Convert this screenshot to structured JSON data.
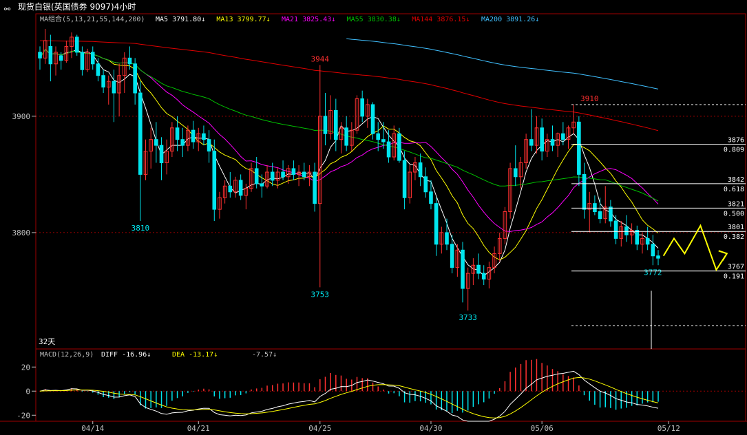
{
  "window": {
    "title": "现货白银(英国债券 9097)4小时",
    "icon": "link-icon"
  },
  "colors": {
    "up": "#ff3030",
    "down": "#00e5ee",
    "ma5": "#ffffff",
    "ma13": "#ffff00",
    "ma21": "#ff00ff",
    "ma55": "#00c000",
    "ma144": "#e00000",
    "ma200": "#40c0ff",
    "frame": "#a00000",
    "axis_text": "#c0c0c0",
    "fib_line": "#ffffff",
    "projection": "#ffff00"
  },
  "legend": {
    "title": "MA组合(5,13,21,55,144,200)",
    "items": [
      {
        "label": "MA5",
        "value": "3791.80",
        "arrow": "↓",
        "color": "#ffffff"
      },
      {
        "label": "MA13",
        "value": "3799.77",
        "arrow": "↓",
        "color": "#ffff00"
      },
      {
        "label": "MA21",
        "value": "3825.43",
        "arrow": "↓",
        "color": "#ff00ff"
      },
      {
        "label": "MA55",
        "value": "3830.38",
        "arrow": "↓",
        "color": "#00c000"
      },
      {
        "label": "MA144",
        "value": "3876.15",
        "arrow": "↓",
        "color": "#e00000"
      },
      {
        "label": "MA200",
        "value": "3891.26",
        "arrow": "↓",
        "color": "#40c0ff"
      }
    ]
  },
  "macd_legend": {
    "title": "MACD(12,26,9)",
    "diff_label": "DIFF",
    "diff_value": "-16.96",
    "diff_arrow": "↓",
    "dea_label": "DEA",
    "dea_value": "-13.17",
    "dea_arrow": "↓",
    "macd_value": "-7.57",
    "macd_arrow": "↓"
  },
  "period_label": "32天",
  "chart_data": [
    {
      "type": "candlestick",
      "title": "现货白银(英国债券 9097)4小时",
      "ylim": [
        3700,
        3978
      ],
      "y_ticks": [
        3800,
        3900
      ],
      "x_tick_labels": [
        {
          "label": "04/14",
          "index": 10
        },
        {
          "label": "04/21",
          "index": 30
        },
        {
          "label": "04/25",
          "index": 53
        },
        {
          "label": "04/30",
          "index": 74
        },
        {
          "label": "05/06",
          "index": 95
        },
        {
          "label": "05/12",
          "index": 119
        }
      ],
      "candles": [
        [
          3955,
          3960,
          3940,
          3950
        ],
        [
          3950,
          3975,
          3945,
          3965
        ],
        [
          3960,
          3970,
          3930,
          3945
        ],
        [
          3945,
          3960,
          3935,
          3955
        ],
        [
          3952,
          3955,
          3940,
          3948
        ],
        [
          3948,
          3965,
          3946,
          3960
        ],
        [
          3960,
          3972,
          3950,
          3968
        ],
        [
          3968,
          3970,
          3952,
          3955
        ],
        [
          3955,
          3960,
          3935,
          3940
        ],
        [
          3940,
          3958,
          3938,
          3955
        ],
        [
          3955,
          3960,
          3940,
          3945
        ],
        [
          3945,
          3950,
          3930,
          3935
        ],
        [
          3935,
          3940,
          3920,
          3925
        ],
        [
          3925,
          3935,
          3910,
          3930
        ],
        [
          3930,
          3940,
          3895,
          3920
        ],
        [
          3920,
          3945,
          3900,
          3935
        ],
        [
          3935,
          3955,
          3920,
          3950
        ],
        [
          3950,
          3960,
          3940,
          3945
        ],
        [
          3945,
          3950,
          3910,
          3920
        ],
        [
          3920,
          3930,
          3810,
          3850
        ],
        [
          3850,
          3880,
          3845,
          3870
        ],
        [
          3870,
          3890,
          3855,
          3880
        ],
        [
          3880,
          3895,
          3860,
          3875
        ],
        [
          3875,
          3882,
          3845,
          3860
        ],
        [
          3860,
          3880,
          3850,
          3870
        ],
        [
          3870,
          3895,
          3865,
          3890
        ],
        [
          3890,
          3900,
          3870,
          3880
        ],
        [
          3880,
          3890,
          3865,
          3875
        ],
        [
          3875,
          3892,
          3870,
          3888
        ],
        [
          3888,
          3896,
          3872,
          3878
        ],
        [
          3878,
          3890,
          3870,
          3885
        ],
        [
          3885,
          3892,
          3875,
          3880
        ],
        [
          3880,
          3888,
          3860,
          3870
        ],
        [
          3870,
          3880,
          3810,
          3820
        ],
        [
          3820,
          3835,
          3812,
          3830
        ],
        [
          3830,
          3845,
          3825,
          3840
        ],
        [
          3840,
          3852,
          3830,
          3835
        ],
        [
          3835,
          3848,
          3830,
          3845
        ],
        [
          3845,
          3850,
          3828,
          3832
        ],
        [
          3832,
          3842,
          3820,
          3838
        ],
        [
          3838,
          3860,
          3835,
          3855
        ],
        [
          3855,
          3865,
          3838,
          3842
        ],
        [
          3842,
          3850,
          3830,
          3840
        ],
        [
          3840,
          3858,
          3838,
          3852
        ],
        [
          3852,
          3860,
          3840,
          3845
        ],
        [
          3845,
          3856,
          3838,
          3852
        ],
        [
          3852,
          3862,
          3845,
          3848
        ],
        [
          3848,
          3858,
          3842,
          3855
        ],
        [
          3855,
          3862,
          3845,
          3850
        ],
        [
          3850,
          3858,
          3840,
          3852
        ],
        [
          3852,
          3860,
          3845,
          3848
        ],
        [
          3848,
          3858,
          3840,
          3852
        ],
        [
          3852,
          3860,
          3818,
          3825
        ],
        [
          3825,
          3944,
          3753,
          3900
        ],
        [
          3900,
          3920,
          3875,
          3885
        ],
        [
          3885,
          3918,
          3880,
          3905
        ],
        [
          3905,
          3915,
          3870,
          3880
        ],
        [
          3880,
          3895,
          3868,
          3890
        ],
        [
          3890,
          3900,
          3870,
          3875
        ],
        [
          3875,
          3895,
          3870,
          3888
        ],
        [
          3888,
          3918,
          3885,
          3915
        ],
        [
          3915,
          3922,
          3895,
          3900
        ],
        [
          3900,
          3915,
          3890,
          3910
        ],
        [
          3910,
          3912,
          3880,
          3885
        ],
        [
          3885,
          3895,
          3870,
          3880
        ],
        [
          3880,
          3895,
          3872,
          3878
        ],
        [
          3878,
          3888,
          3860,
          3865
        ],
        [
          3865,
          3892,
          3862,
          3885
        ],
        [
          3885,
          3890,
          3860,
          3862
        ],
        [
          3862,
          3870,
          3820,
          3830
        ],
        [
          3830,
          3858,
          3825,
          3852
        ],
        [
          3852,
          3865,
          3845,
          3860
        ],
        [
          3860,
          3868,
          3840,
          3848
        ],
        [
          3848,
          3856,
          3830,
          3835
        ],
        [
          3835,
          3845,
          3820,
          3825
        ],
        [
          3825,
          3830,
          3780,
          3790
        ],
        [
          3790,
          3805,
          3782,
          3800
        ],
        [
          3800,
          3812,
          3785,
          3790
        ],
        [
          3790,
          3798,
          3765,
          3770
        ],
        [
          3770,
          3790,
          3762,
          3785
        ],
        [
          3785,
          3792,
          3740,
          3752
        ],
        [
          3752,
          3770,
          3733,
          3765
        ],
        [
          3765,
          3778,
          3755,
          3772
        ],
        [
          3772,
          3782,
          3760,
          3765
        ],
        [
          3765,
          3772,
          3755,
          3760
        ],
        [
          3760,
          3775,
          3752,
          3770
        ],
        [
          3770,
          3788,
          3765,
          3782
        ],
        [
          3782,
          3800,
          3775,
          3795
        ],
        [
          3795,
          3822,
          3790,
          3818
        ],
        [
          3818,
          3860,
          3812,
          3855
        ],
        [
          3855,
          3875,
          3840,
          3848
        ],
        [
          3848,
          3865,
          3838,
          3860
        ],
        [
          3860,
          3885,
          3855,
          3880
        ],
        [
          3880,
          3906,
          3870,
          3875
        ],
        [
          3875,
          3900,
          3868,
          3890
        ],
        [
          3890,
          3898,
          3862,
          3870
        ],
        [
          3870,
          3885,
          3865,
          3880
        ],
        [
          3880,
          3892,
          3870,
          3875
        ],
        [
          3875,
          3886,
          3865,
          3885
        ],
        [
          3885,
          3895,
          3875,
          3880
        ],
        [
          3880,
          3892,
          3872,
          3890
        ],
        [
          3890,
          3910,
          3885,
          3895
        ],
        [
          3895,
          3900,
          3840,
          3850
        ],
        [
          3850,
          3860,
          3812,
          3820
        ],
        [
          3820,
          3835,
          3800,
          3825
        ],
        [
          3825,
          3832,
          3815,
          3818
        ],
        [
          3818,
          3830,
          3808,
          3812
        ],
        [
          3812,
          3840,
          3808,
          3822
        ],
        [
          3822,
          3828,
          3805,
          3810
        ],
        [
          3810,
          3815,
          3790,
          3795
        ],
        [
          3795,
          3810,
          3788,
          3805
        ],
        [
          3805,
          3815,
          3792,
          3798
        ],
        [
          3798,
          3808,
          3790,
          3802
        ],
        [
          3802,
          3806,
          3785,
          3790
        ],
        [
          3790,
          3800,
          3782,
          3795
        ],
        [
          3795,
          3805,
          3785,
          3790
        ],
        [
          3790,
          3798,
          3772,
          3780
        ],
        [
          3780,
          3785,
          3772,
          3778
        ]
      ],
      "annotations": [
        {
          "text": "3944",
          "index": 53,
          "value": 3944,
          "position": "above",
          "color": "#ff3030"
        },
        {
          "text": "3910",
          "index": 104,
          "value": 3910,
          "position": "above",
          "color": "#ff3030"
        },
        {
          "text": "3810",
          "index": 19,
          "value": 3810,
          "position": "below",
          "color": "#00e5ee"
        },
        {
          "text": "3753",
          "index": 53,
          "value": 3753,
          "position": "below",
          "color": "#00e5ee"
        },
        {
          "text": "3733",
          "index": 81,
          "value": 3733,
          "position": "below",
          "color": "#00e5ee"
        },
        {
          "text": "3772",
          "index": 116,
          "value": 3772,
          "position": "below",
          "color": "#00e5ee"
        }
      ],
      "fibonacci": [
        {
          "price": "3876",
          "ratio": "0.809",
          "value": 3876
        },
        {
          "price": "3842",
          "ratio": "0.618",
          "value": 3842
        },
        {
          "price": "3821",
          "ratio": "0.500",
          "value": 3821
        },
        {
          "price": "3801",
          "ratio": "0.382",
          "value": 3801
        },
        {
          "price": "3767",
          "ratio": "0.191",
          "value": 3767
        }
      ],
      "fib_dashed_levels": [
        3910,
        3720
      ],
      "projection_path": [
        [
          118,
          3780
        ],
        [
          120,
          3795
        ],
        [
          122,
          3782
        ],
        [
          125,
          3806
        ],
        [
          128,
          3768
        ],
        [
          130,
          3782
        ]
      ]
    },
    {
      "type": "bar",
      "title": "MACD(12,26,9)",
      "ylim": [
        -25,
        27
      ],
      "y_ticks": [
        20,
        0,
        -20
      ],
      "zero_line": 0
    }
  ]
}
